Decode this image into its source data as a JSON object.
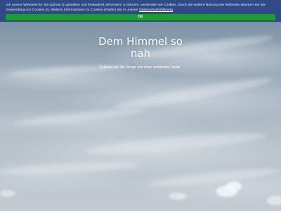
{
  "cookie_banner": {
    "text_before_link": "Um unsere Webseite für Sie optimal zu gestalten und fortlaufend verbessern zu können, verwenden wir Cookies. Durch die weitere Nutzung der Webseite stimmen Sie der Verwendung von Cookies zu. Weitere Informationen zu Cookies erhalten Sie in unserer ",
    "link_label": "Datenschutzerklärung",
    "ok_label": "OK",
    "background_color": "#304a86",
    "ok_button_color": "#1b9a35"
  },
  "hero": {
    "title": "Dem Himmel so nah",
    "subtitle": "Erleben sie die Berge von ihrer schönsten Seite."
  }
}
